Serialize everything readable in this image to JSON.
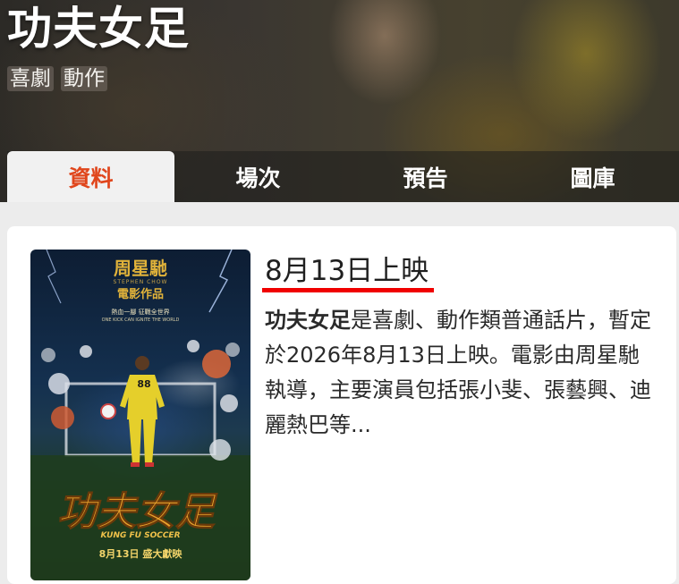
{
  "header": {
    "title": "功夫女足",
    "genres": [
      "喜劇",
      "動作"
    ]
  },
  "tabs": [
    {
      "label": "資料",
      "active": true
    },
    {
      "label": "場次",
      "active": false
    },
    {
      "label": "預告",
      "active": false
    },
    {
      "label": "圖庫",
      "active": false
    }
  ],
  "info": {
    "release_heading": "8月13日上映",
    "synopsis_name": "功夫女足",
    "synopsis_text": "是喜劇、動作類普通話片，暫定於2026年8月13日上映。電影由周星馳執導，主要演員包括張小斐、張藝興、迪麗熱巴等..."
  },
  "poster": {
    "presenter": "周星馳",
    "presenter_en": "STEPHEN CHOW",
    "presenter_sub": "電影作品",
    "tagline": "熱血一腳 征戰全世界",
    "tagline_en": "ONE KICK CAN IGNITE THE WORLD",
    "jersey_number": "88",
    "logo_text": "功夫女足",
    "logo_en": "KUNG FU SOCCER",
    "release": "8月13日 盛大獻映"
  },
  "colors": {
    "accent": "#e0461c",
    "underline": "#f00000",
    "poster_gold": "#e0b23a",
    "jersey_yellow": "#e5cf2b"
  }
}
